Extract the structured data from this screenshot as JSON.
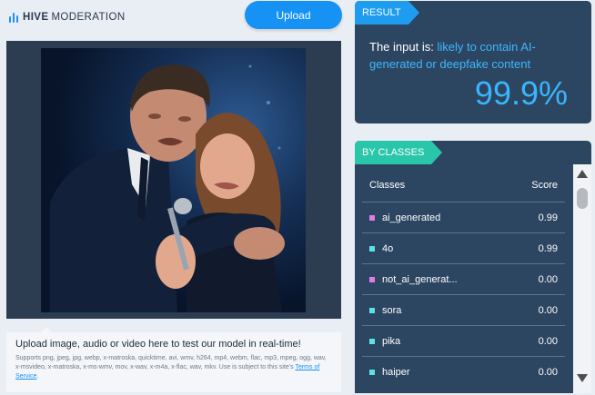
{
  "header": {
    "logo_brand": "HIVE",
    "logo_sub": "MODERATION",
    "upload_label": "Upload"
  },
  "caption": {
    "title": "Upload image, audio or video here to test our model in real-time!",
    "formats": "Supports png, jpeg, jpg, webp, x-matroska, quicktime, avi, wmv, h264, mp4, webm, flac, mp3, mpeg, ogg, wav, x-msvideo, x-matroska, x-ms-wmv, mov, x-wav, x-m4a, x-flac, wav, mkv. Use is subject to this site's",
    "terms_link": "Terms of Service",
    "terms_end": "."
  },
  "result": {
    "tag": "RESULT",
    "prefix": "The input is:",
    "verdict": "likely to contain AI-generated or deepfake content",
    "score": "99.9%"
  },
  "classes": {
    "tag": "BY CLASSES",
    "col_class": "Classes",
    "col_score": "Score",
    "rows": [
      {
        "label": "ai_generated",
        "score": "0.99",
        "color": "#e07ce8"
      },
      {
        "label": "4o",
        "score": "0.99",
        "color": "#5ce1e6"
      },
      {
        "label": "not_ai_generat...",
        "score": "0.00",
        "color": "#e07ce8"
      },
      {
        "label": "sora",
        "score": "0.00",
        "color": "#5ce1e6"
      },
      {
        "label": "pika",
        "score": "0.00",
        "color": "#5ce1e6"
      },
      {
        "label": "haiper",
        "score": "0.00",
        "color": "#5ce1e6"
      }
    ]
  },
  "icons": {
    "logo": "hive-logo-icon",
    "scroll_up": "scroll-up-arrow-icon",
    "scroll_down": "scroll-down-arrow-icon"
  },
  "colors": {
    "accent": "#1592f3",
    "result_tag": "#1d9cf0",
    "classes_tag": "#2ac6a9",
    "panel_bg": "#2c4561",
    "score_color": "#39b6ff"
  }
}
